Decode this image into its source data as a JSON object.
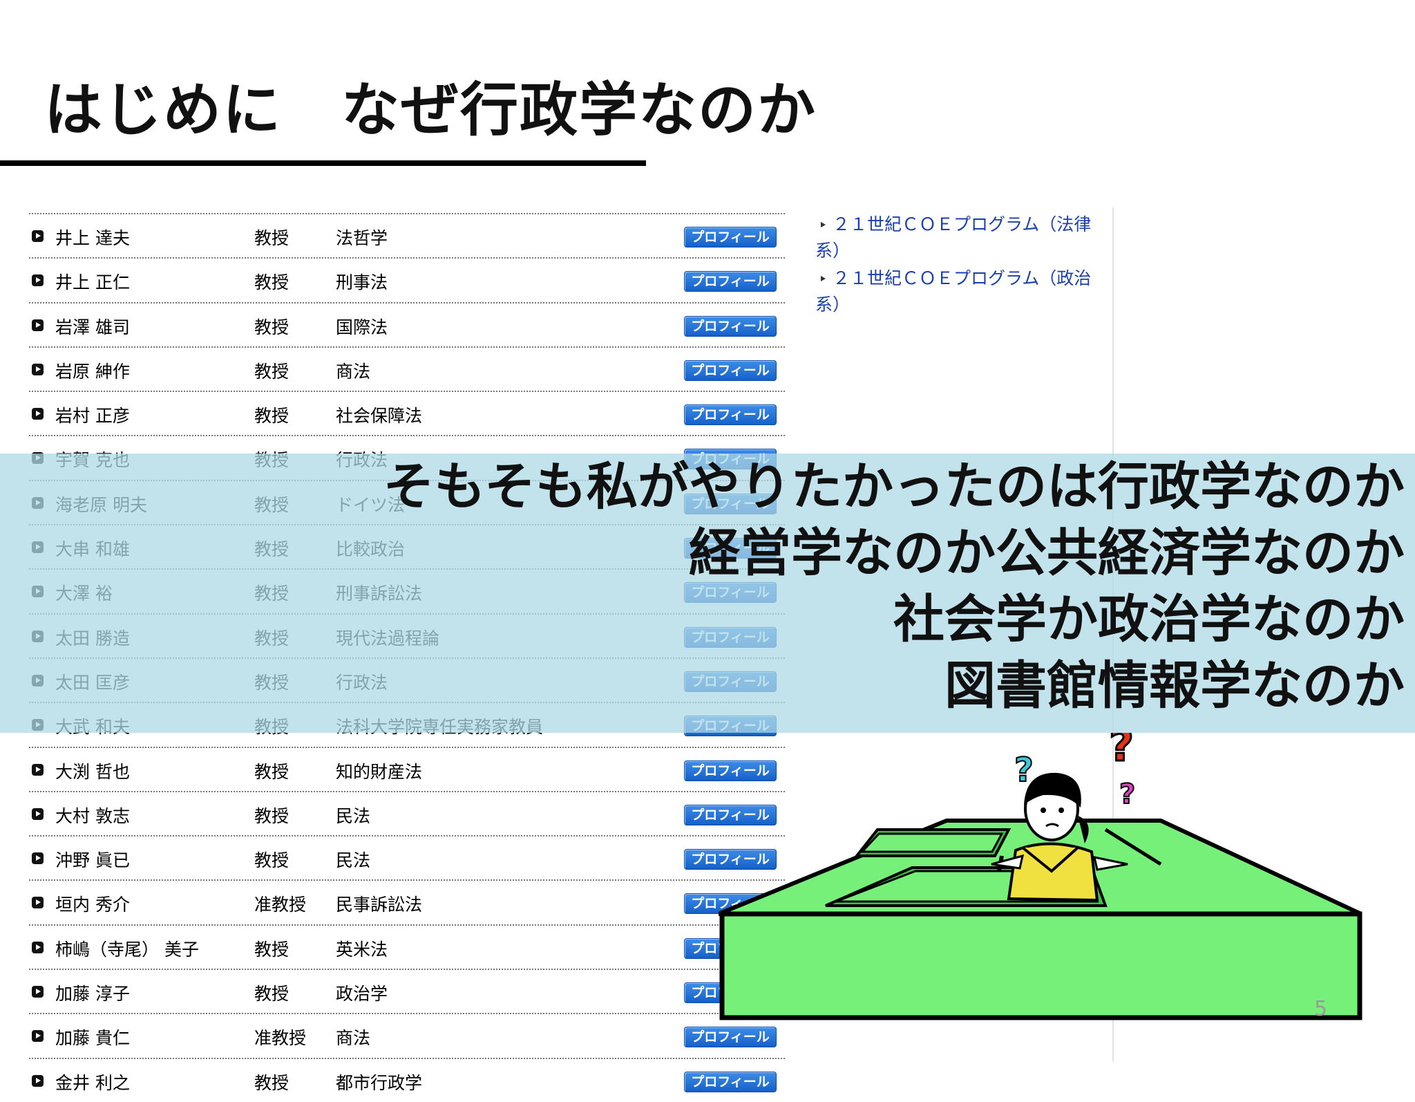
{
  "title": "はじめに　なぜ行政学なのか",
  "faculty": [
    {
      "name": "井上 達夫",
      "rank": "教授",
      "field": "法哲学",
      "button": "プロフィール"
    },
    {
      "name": "井上 正仁",
      "rank": "教授",
      "field": "刑事法",
      "button": "プロフィール"
    },
    {
      "name": "岩澤 雄司",
      "rank": "教授",
      "field": "国際法",
      "button": "プロフィール"
    },
    {
      "name": "岩原 紳作",
      "rank": "教授",
      "field": "商法",
      "button": "プロフィール"
    },
    {
      "name": "岩村 正彦",
      "rank": "教授",
      "field": "社会保障法",
      "button": "プロフィール"
    },
    {
      "name": "宇賀 克也",
      "rank": "教授",
      "field": "行政法",
      "button": "プロフィール"
    },
    {
      "name": "海老原 明夫",
      "rank": "教授",
      "field": "ドイツ法",
      "button": "プロフィール"
    },
    {
      "name": "大串 和雄",
      "rank": "教授",
      "field": "比較政治",
      "button": "プロフィール"
    },
    {
      "name": "大澤 裕",
      "rank": "教授",
      "field": "刑事訴訟法",
      "button": "プロフィール"
    },
    {
      "name": "太田 勝造",
      "rank": "教授",
      "field": "現代法過程論",
      "button": "プロフィール"
    },
    {
      "name": "太田 匡彦",
      "rank": "教授",
      "field": "行政法",
      "button": "プロフィール"
    },
    {
      "name": "大武 和夫",
      "rank": "教授",
      "field": "法科大学院専任実務家教員",
      "button": "プロフィール"
    },
    {
      "name": "大渕 哲也",
      "rank": "教授",
      "field": "知的財産法",
      "button": "プロフィール"
    },
    {
      "name": "大村 敦志",
      "rank": "教授",
      "field": "民法",
      "button": "プロフィール"
    },
    {
      "name": "沖野 眞已",
      "rank": "教授",
      "field": "民法",
      "button": "プロフィール"
    },
    {
      "name": "垣内 秀介",
      "rank": "准教授",
      "field": "民事訴訟法",
      "button": "プロフィール"
    },
    {
      "name": "柿嶋（寺尾） 美子",
      "rank": "教授",
      "field": "英米法",
      "button": "プロフィール"
    },
    {
      "name": "加藤 淳子",
      "rank": "教授",
      "field": "政治学",
      "button": "プロフィール"
    },
    {
      "name": "加藤 貴仁",
      "rank": "准教授",
      "field": "商法",
      "button": "プロフィール"
    },
    {
      "name": "金井 利之",
      "rank": "教授",
      "field": "都市行政学",
      "button": "プロフィール"
    }
  ],
  "sidebar_links": [
    "２１世紀ＣＯＥプログラム（法律系）",
    "２１世紀ＣＯＥプログラム（政治系）"
  ],
  "overlay_lines": [
    "そもそも私がやりたかったのは行政学なのか",
    "経営学なのか公共経済学なのか",
    "社会学か政治学なのか",
    "図書館情報学なのか"
  ],
  "page_number": "5",
  "colors": {
    "band": "#add8e6",
    "profile_button": "#1a66cc",
    "link": "#1a3fb0",
    "maze": "#77f07a",
    "question_red": "#e8301c",
    "question_cyan": "#3cc8d8",
    "question_magenta": "#e040c0",
    "shirt": "#f0e040"
  },
  "illustration": {
    "icons": [
      "maze-icon",
      "confused-person-icon",
      "question-mark-icon"
    ]
  }
}
